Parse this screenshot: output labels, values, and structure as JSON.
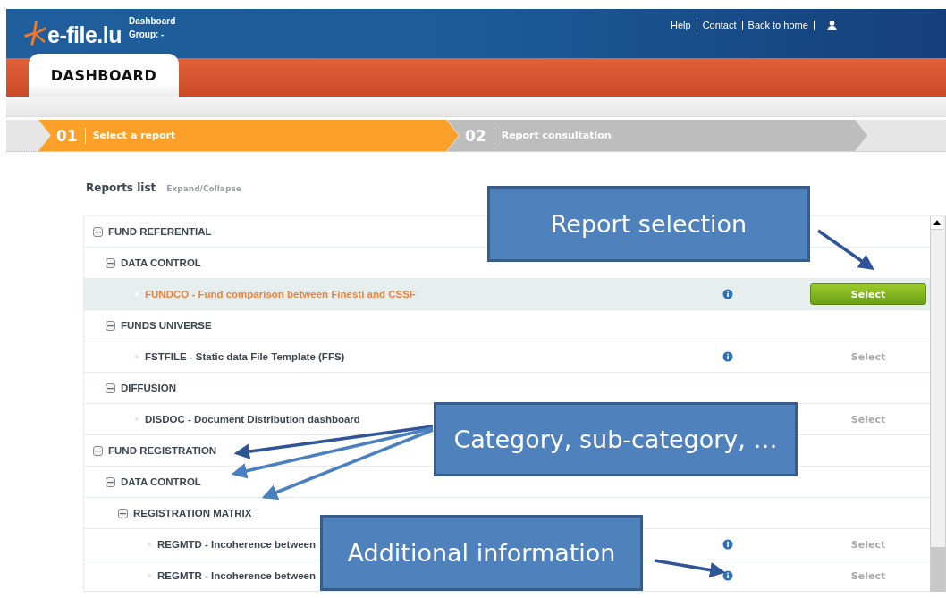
{
  "header": {
    "logo": "e-file.lu",
    "context": [
      "Dashboard",
      "Group: -"
    ],
    "links": [
      "Help",
      "Contact",
      "Back to home"
    ]
  },
  "tab": {
    "label": "DASHBOARD"
  },
  "steps": [
    {
      "number": "01",
      "label": "Select a report",
      "selected": true
    },
    {
      "number": "02",
      "label": "Report consultation",
      "selected": false
    }
  ],
  "reports_list": {
    "title": "Reports list",
    "toggle": "Expand/Collapse"
  },
  "tree": [
    {
      "kind": "category",
      "label": "FUND REFERENTIAL",
      "expanded": true,
      "children": [
        {
          "kind": "category",
          "label": "DATA CONTROL",
          "expanded": true,
          "children": [
            {
              "kind": "report",
              "label": "FUNDCO - Fund comparison between Finesti and CSSF",
              "selected": true,
              "info": true,
              "action": "Select"
            }
          ]
        },
        {
          "kind": "category",
          "label": "FUNDS UNIVERSE",
          "expanded": true,
          "children": [
            {
              "kind": "report",
              "label": "FSTFILE - Static data File Template (FFS)",
              "selected": false,
              "info": true,
              "action": "Select"
            }
          ]
        },
        {
          "kind": "category",
          "label": "DIFFUSION",
          "expanded": true,
          "children": [
            {
              "kind": "report",
              "label": "DISDOC - Document Distribution dashboard",
              "selected": false,
              "action": "Select"
            }
          ]
        }
      ]
    },
    {
      "kind": "category",
      "label": "FUND REGISTRATION",
      "expanded": true,
      "children": [
        {
          "kind": "category",
          "label": "DATA CONTROL",
          "expanded": true,
          "children": [
            {
              "kind": "category",
              "label": "REGISTRATION MATRIX",
              "expanded": true,
              "children": [
                {
                  "kind": "report",
                  "label": "REGMTD - Incoherence between",
                  "selected": false,
                  "info": true,
                  "action": "Select"
                },
                {
                  "kind": "report",
                  "label": "REGMTR - Incoherence between",
                  "selected": false,
                  "info": true,
                  "action": "Select"
                }
              ]
            }
          ]
        }
      ]
    }
  ],
  "callouts": [
    "Report selection",
    "Category, sub-category, …",
    "Additional information"
  ]
}
